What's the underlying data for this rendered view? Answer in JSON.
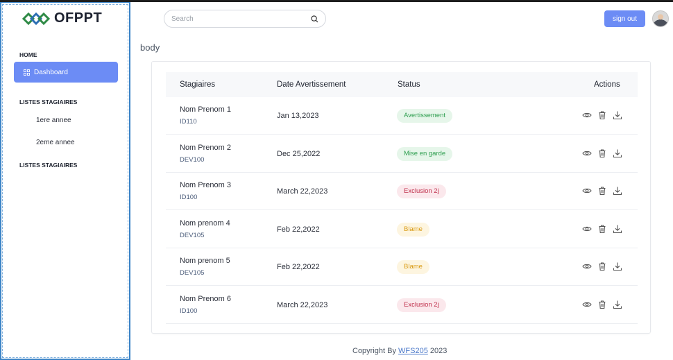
{
  "brand": {
    "name": "OFPPT"
  },
  "sidebar": {
    "home_heading": "HOME",
    "dashboard_label": "Dashboard",
    "section1_heading": "LISTES STAGIAIRES",
    "links": [
      "1ere annee",
      "2eme annee"
    ],
    "section2_heading": "LISTES STAGIAIRES"
  },
  "header": {
    "search_placeholder": "Search",
    "signout_label": "sign out"
  },
  "page": {
    "label": "body"
  },
  "table": {
    "columns": [
      "Stagiaires",
      "Date Avertissement",
      "Status",
      "Actions"
    ],
    "rows": [
      {
        "name": "Nom Prenom 1",
        "id": "ID110",
        "date": "Jan 13,2023",
        "status": "Avertissement",
        "status_type": "success"
      },
      {
        "name": "Nom Prenom 2",
        "id": "DEV100",
        "date": "Dec 25,2022",
        "status": "Mise en garde",
        "status_type": "success"
      },
      {
        "name": "Nom Prenom 3",
        "id": "ID100",
        "date": "March 22,2023",
        "status": "Exclusion 2j",
        "status_type": "danger"
      },
      {
        "name": "Nom prenom 4",
        "id": "DEV105",
        "date": "Feb 22,2022",
        "status": "Blame",
        "status_type": "warning"
      },
      {
        "name": "Nom prenom 5",
        "id": "DEV105",
        "date": "Feb 22,2022",
        "status": "Blame",
        "status_type": "warning"
      },
      {
        "name": "Nom Prenom 6",
        "id": "ID100",
        "date": "March 22,2023",
        "status": "Exclusion 2j",
        "status_type": "danger"
      }
    ],
    "action_icons": [
      "eye-icon",
      "trash-icon",
      "download-icon"
    ]
  },
  "badge_colors": {
    "success": {
      "bg": "#e6f6ea",
      "fg": "#2e9e4f"
    },
    "danger": {
      "bg": "#fbe8ec",
      "fg": "#c0314d"
    },
    "warning": {
      "bg": "#fdf5e0",
      "fg": "#d99a12"
    }
  },
  "footer": {
    "prefix": "Copyright By",
    "link": "WFS205",
    "year": "2023"
  },
  "colors": {
    "accent": "#6c8cf5",
    "sidebar_border": "#3b83c6"
  }
}
